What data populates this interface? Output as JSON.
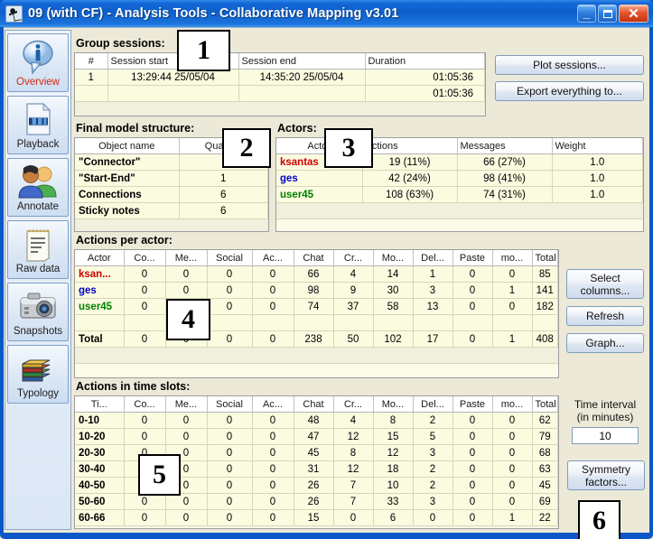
{
  "window": {
    "title": "09 (with CF) - Analysis Tools - Collaborative Mapping v3.01",
    "app_icon": "app-icon",
    "minimize_label": "_",
    "maximize_label": "",
    "close_label": "✕"
  },
  "sidebar": {
    "items": [
      {
        "label": "Overview",
        "icon": "info-balloon-icon",
        "active": true
      },
      {
        "label": "Playback",
        "icon": "film-page-icon",
        "active": false
      },
      {
        "label": "Annotate",
        "icon": "two-people-icon",
        "active": false
      },
      {
        "label": "Raw data",
        "icon": "notepad-icon",
        "active": false
      },
      {
        "label": "Snapshots",
        "icon": "camera-icon",
        "active": false
      },
      {
        "label": "Typology",
        "icon": "books-stack-icon",
        "active": false
      }
    ]
  },
  "group_sessions": {
    "title": "Group sessions:",
    "headers": [
      "#",
      "Session start",
      "Session end",
      "Duration"
    ],
    "rows": [
      [
        "1",
        "13:29:44 25/05/04",
        "14:35:20 25/05/04",
        "01:05:36"
      ],
      [
        "",
        "",
        "",
        "01:05:36"
      ]
    ],
    "buttons": [
      "Plot sessions...",
      "Export everything to..."
    ]
  },
  "final_model": {
    "title": "Final model structure:",
    "headers": [
      "Object name",
      "Quantity"
    ],
    "rows": [
      [
        "\"Connector\"",
        "6"
      ],
      [
        "\"Start-End\"",
        "1"
      ],
      [
        "Connections",
        "6"
      ],
      [
        "Sticky notes",
        "6"
      ]
    ]
  },
  "actors": {
    "title": "Actors:",
    "headers": [
      "Actor",
      "Actions",
      "Messages",
      "Weight"
    ],
    "rows": [
      {
        "actor": "ksantas",
        "color": "#cc0000",
        "actions": "19 (11%)",
        "messages": "66 (27%)",
        "weight": "1.0"
      },
      {
        "actor": "ges",
        "color": "#0000cc",
        "actions": "42 (24%)",
        "messages": "98 (41%)",
        "weight": "1.0"
      },
      {
        "actor": "user45",
        "color": "#008000",
        "actions": "108 (63%)",
        "messages": "74 (31%)",
        "weight": "1.0"
      }
    ]
  },
  "actions_per_actor": {
    "title": "Actions per actor:",
    "headers": [
      "Actor",
      "Co...",
      "Me...",
      "Social",
      "Ac...",
      "Chat",
      "Cr...",
      "Mo...",
      "Del...",
      "Paste",
      "mo...",
      "Total"
    ],
    "rows": [
      {
        "label": "ksan...",
        "color": "#cc0000",
        "values": [
          "0",
          "0",
          "0",
          "0",
          "66",
          "4",
          "14",
          "1",
          "0",
          "0",
          "85"
        ]
      },
      {
        "label": "ges",
        "color": "#0000cc",
        "values": [
          "0",
          "0",
          "0",
          "0",
          "98",
          "9",
          "30",
          "3",
          "0",
          "1",
          "141"
        ]
      },
      {
        "label": "user45",
        "color": "#008000",
        "values": [
          "0",
          "0",
          "0",
          "0",
          "74",
          "37",
          "58",
          "13",
          "0",
          "0",
          "182"
        ]
      }
    ],
    "total_row": {
      "label": "Total",
      "color": "#000000",
      "values": [
        "0",
        "0",
        "0",
        "0",
        "238",
        "50",
        "102",
        "17",
        "0",
        "1",
        "408"
      ]
    },
    "buttons": [
      "Select columns...",
      "Refresh",
      "Graph..."
    ]
  },
  "time_slots": {
    "title": "Actions in time slots:",
    "headers": [
      "Ti...",
      "Co...",
      "Me...",
      "Social",
      "Ac...",
      "Chat",
      "Cr...",
      "Mo...",
      "Del...",
      "Paste",
      "mo...",
      "Total"
    ],
    "rows": [
      {
        "label": "0-10",
        "values": [
          "0",
          "0",
          "0",
          "0",
          "48",
          "4",
          "8",
          "2",
          "0",
          "0",
          "62"
        ]
      },
      {
        "label": "10-20",
        "values": [
          "0",
          "0",
          "0",
          "0",
          "47",
          "12",
          "15",
          "5",
          "0",
          "0",
          "79"
        ]
      },
      {
        "label": "20-30",
        "values": [
          "0",
          "0",
          "0",
          "0",
          "45",
          "8",
          "12",
          "3",
          "0",
          "0",
          "68"
        ]
      },
      {
        "label": "30-40",
        "values": [
          "0",
          "0",
          "0",
          "0",
          "31",
          "12",
          "18",
          "2",
          "0",
          "0",
          "63"
        ]
      },
      {
        "label": "40-50",
        "values": [
          "0",
          "0",
          "0",
          "0",
          "26",
          "7",
          "10",
          "2",
          "0",
          "0",
          "45"
        ]
      },
      {
        "label": "50-60",
        "values": [
          "0",
          "0",
          "0",
          "0",
          "26",
          "7",
          "33",
          "3",
          "0",
          "0",
          "69"
        ]
      },
      {
        "label": "60-66",
        "values": [
          "0",
          "0",
          "0",
          "0",
          "15",
          "0",
          "6",
          "0",
          "0",
          "1",
          "22"
        ]
      }
    ],
    "interval_label_line1": "Time interval",
    "interval_label_line2": "(in minutes)",
    "interval_value": "10",
    "symmetry_button": "Symmetry factors..."
  },
  "callouts": [
    {
      "num": "1"
    },
    {
      "num": "2"
    },
    {
      "num": "3"
    },
    {
      "num": "4"
    },
    {
      "num": "5"
    },
    {
      "num": "6"
    }
  ]
}
